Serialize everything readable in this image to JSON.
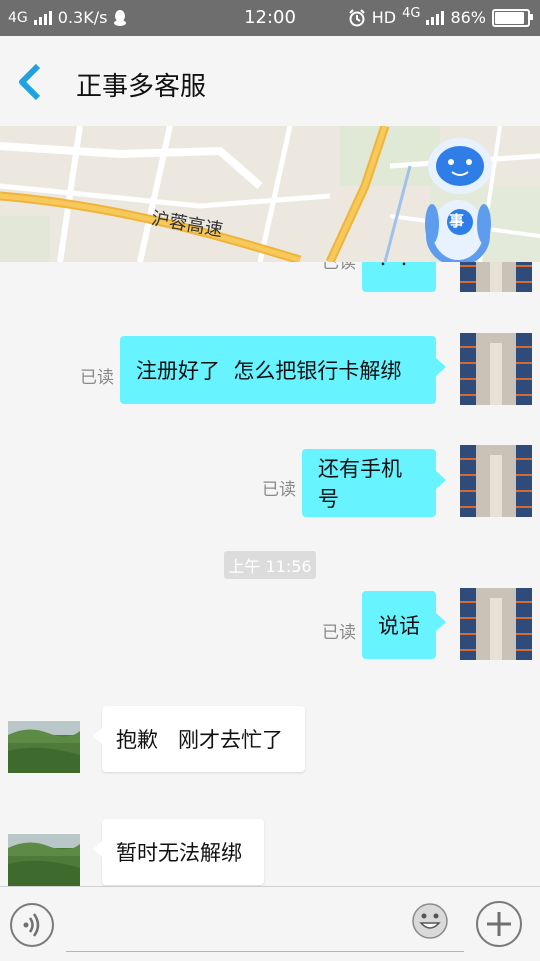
{
  "status_bar": {
    "network": "4G",
    "speed": "0.3K/s",
    "time": "12:00",
    "hd_label": "HD",
    "network_right": "4G",
    "battery": "86%"
  },
  "header": {
    "title": "正事多客服"
  },
  "map": {
    "road_label": "沪蓉高速",
    "robot_badge": "事"
  },
  "chat": {
    "time_separator": "上午 11:56",
    "messages": [
      {
        "dir": "out",
        "text": "？？",
        "status": "已读"
      },
      {
        "dir": "out",
        "text": "注册好了  怎么把银行卡解绑",
        "status": "已读"
      },
      {
        "dir": "out",
        "text": "还有手机号",
        "status": "已读"
      },
      {
        "dir": "out",
        "text": "说话",
        "status": "已读"
      },
      {
        "dir": "in",
        "text": "抱歉   刚才去忙了"
      },
      {
        "dir": "in",
        "text": "暂时无法解绑"
      }
    ]
  },
  "input_bar": {
    "placeholder": ""
  },
  "colors": {
    "outgoing_bubble": "#67f3ff",
    "back_arrow": "#1fa3e0",
    "status_bar": "#6e6e6e"
  }
}
